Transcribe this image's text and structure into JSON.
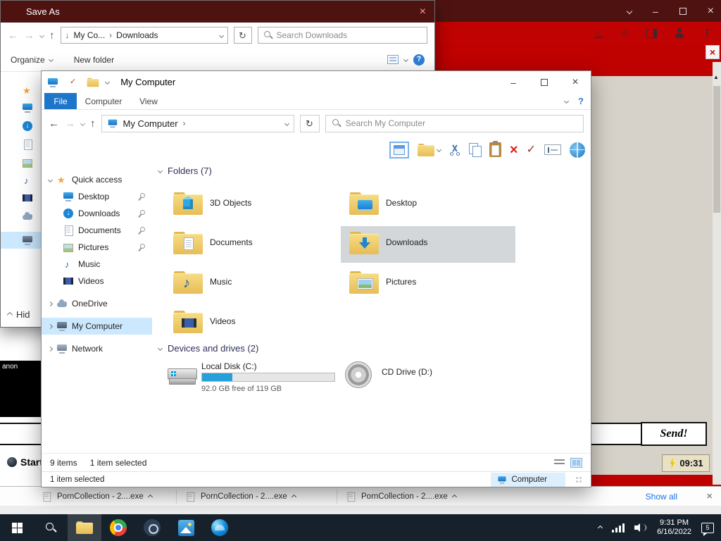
{
  "browser": {
    "downloads_bar": {
      "items": [
        {
          "filename": "PornCollection - 2....exe"
        },
        {
          "filename": "PornCollection - 2....exe"
        },
        {
          "filename": "PornCollection - 2....exe"
        }
      ],
      "show_all_label": "Show all"
    }
  },
  "save_dialog": {
    "title": "Save As",
    "breadcrumb_root": "My Co...",
    "breadcrumb_current": "Downloads",
    "search_placeholder": "Search Downloads",
    "organize_label": "Organize",
    "new_folder_label": "New folder",
    "hide_folders_label": "Hid"
  },
  "explorer": {
    "title": "My Computer",
    "tab_file": "File",
    "tab_computer": "Computer",
    "tab_view": "View",
    "address": "My Computer",
    "search_placeholder": "Search My Computer",
    "sidebar": {
      "quick_access_label": "Quick access",
      "items": [
        {
          "label": "Desktop"
        },
        {
          "label": "Downloads"
        },
        {
          "label": "Documents"
        },
        {
          "label": "Pictures"
        },
        {
          "label": "Music"
        },
        {
          "label": "Videos"
        }
      ],
      "onedrive_label": "OneDrive",
      "this_pc_label": "My Computer",
      "network_label": "Network"
    },
    "groups": {
      "folders_title": "Folders (7)",
      "drives_title": "Devices and drives (2)"
    },
    "folders": [
      {
        "name": "3D Objects"
      },
      {
        "name": "Desktop"
      },
      {
        "name": "Documents"
      },
      {
        "name": "Downloads"
      },
      {
        "name": "Music"
      },
      {
        "name": "Pictures"
      },
      {
        "name": "Videos"
      }
    ],
    "drives": {
      "local_disk_name": "Local Disk (C:)",
      "local_disk_free": "92.0 GB free of 119 GB",
      "local_disk_fill_percent": 23,
      "cd_drive_name": "CD Drive (D:)"
    },
    "status_items": "9 items",
    "status_selected": "1 item selected",
    "footer_selected": "1 item selected",
    "footer_location": "Computer"
  },
  "page": {
    "send_label": "Send!",
    "timer_value": "09:31",
    "start_label": "Start",
    "video_label": "anon"
  },
  "taskbar": {
    "clock_time": "9:31 PM",
    "clock_date": "6/16/2022",
    "notification_count": "5"
  }
}
